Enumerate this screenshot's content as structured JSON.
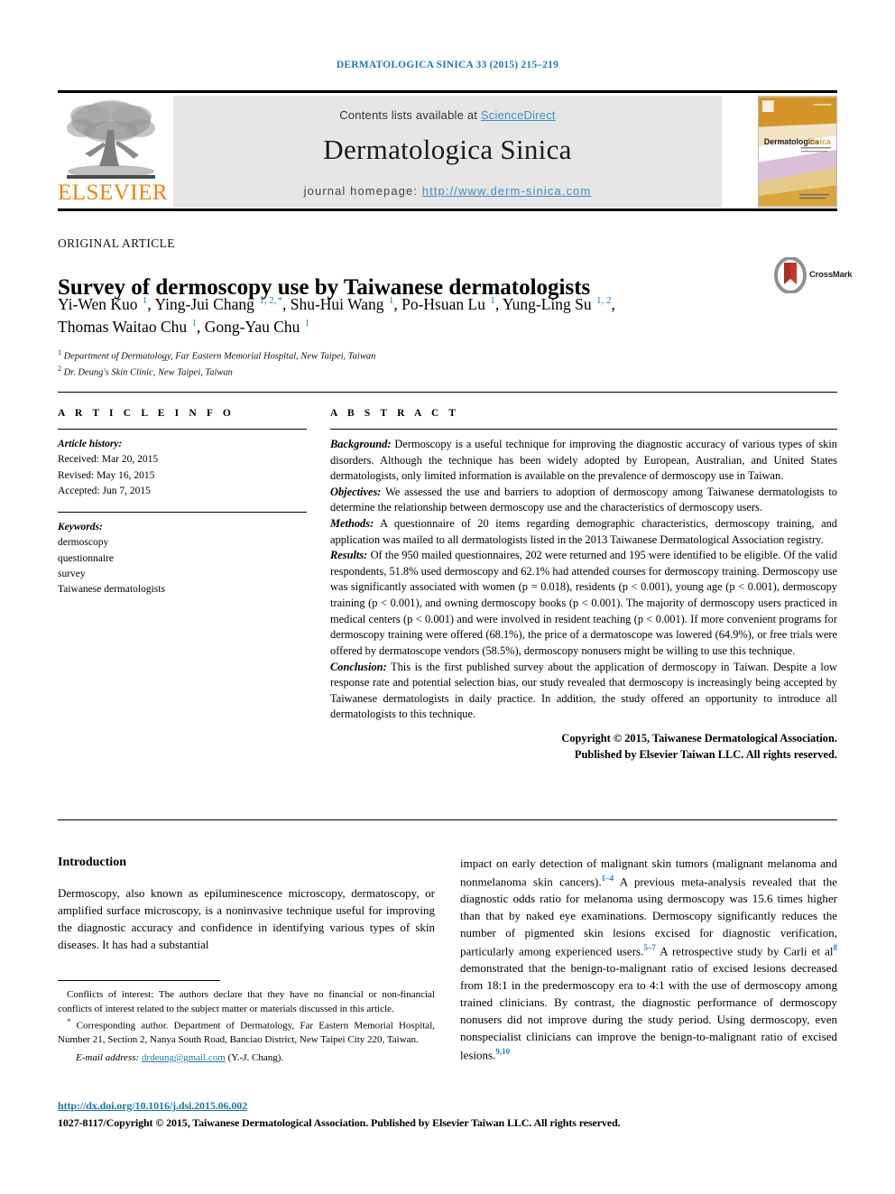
{
  "running_head": "DERMATOLOGICA SINICA 33 (2015) 215–219",
  "masthead": {
    "publisher_name": "ELSEVIER",
    "publisher_logo_icon": "elsevier-tree-logo",
    "contents_prefix": "Contents lists available at ",
    "contents_link": "ScienceDirect",
    "journal_title": "Dermatologica Sinica",
    "homepage_prefix": "journal homepage: ",
    "homepage_url": "http://www.derm-sinica.com",
    "cover_thumb_title": "Dermatologica Sinica"
  },
  "article": {
    "type": "ORIGINAL ARTICLE",
    "title": "Survey of dermoscopy use by Taiwanese dermatologists",
    "crossmark_label": "CrossMark",
    "authors_line1": "Yi-Wen Kuo",
    "authors_html": "Yi-Wen Kuo <sup>1</sup>, Ying-Jui Chang <sup>1, 2,</sup><sup>*</sup>, Shu-Hui Wang <sup>1</sup>, Po-Hsuan Lu <sup>1</sup>, Yung-Ling Su <sup>1, 2</sup>, Thomas Waitao Chu <sup>1</sup>, Gong-Yau Chu <sup>1</sup>",
    "affiliation_1": "Department of Dermatology, Far Eastern Memorial Hospital, New Taipei, Taiwan",
    "affiliation_2": "Dr. Deung's Skin Clinic, New Taipei, Taiwan"
  },
  "info": {
    "heading": "A R T I C L E   I N F O",
    "history_label": "Article history:",
    "history": [
      "Received: Mar 20, 2015",
      "Revised: May 16, 2015",
      "Accepted: Jun 7, 2015"
    ],
    "keywords_label": "Keywords:",
    "keywords": [
      "dermoscopy",
      "questionnaire",
      "survey",
      "Taiwanese dermatologists"
    ]
  },
  "abstract": {
    "heading": "A B S T R A C T",
    "background_label": "Background:",
    "background_text": " Dermoscopy is a useful technique for improving the diagnostic accuracy of various types of skin disorders. Although the technique has been widely adopted by European, Australian, and United States dermatologists, only limited information is available on the prevalence of dermoscopy use in Taiwan.",
    "objectives_label": "Objectives:",
    "objectives_text": " We assessed the use and barriers to adoption of dermoscopy among Taiwanese dermatologists to determine the relationship between dermoscopy use and the characteristics of dermoscopy users.",
    "methods_label": "Methods:",
    "methods_text": " A questionnaire of 20 items regarding demographic characteristics, dermoscopy training, and application was mailed to all dermatologists listed in the 2013 Taiwanese Dermatological Association registry.",
    "results_label": "Results:",
    "results_text": " Of the 950 mailed questionnaires, 202 were returned and 195 were identified to be eligible. Of the valid respondents, 51.8% used dermoscopy and 62.1% had attended courses for dermoscopy training. Dermoscopy use was significantly associated with women (p = 0.018), residents (p < 0.001), young age (p < 0.001), dermoscopy training (p < 0.001), and owning dermoscopy books (p < 0.001). The majority of dermoscopy users practiced in medical centers (p < 0.001) and were involved in resident teaching (p < 0.001). If more convenient programs for dermoscopy training were offered (68.1%), the price of a dermatoscope was lowered (64.9%), or free trials were offered by dermatoscope vendors (58.5%), dermoscopy nonusers might be willing to use this technique.",
    "conclusion_label": "Conclusion:",
    "conclusion_text": " This is the first published survey about the application of dermoscopy in Taiwan. Despite a low response rate and potential selection bias, our study revealed that dermoscopy is increasingly being accepted by Taiwanese dermatologists in daily practice. In addition, the study offered an opportunity to introduce all dermatologists to this technique.",
    "copyright_line1": "Copyright © 2015, Taiwanese Dermatological Association.",
    "copyright_line2": "Published by Elsevier Taiwan LLC. All rights reserved."
  },
  "body": {
    "intro_heading": "Introduction",
    "intro_left": "Dermoscopy, also known as epiluminescence microscopy, dermatoscopy, or amplified surface microscopy, is a noninvasive technique useful for improving the diagnostic accuracy and confidence in identifying various types of skin diseases. It has had a substantial",
    "intro_right_1": "impact on early detection of malignant skin tumors (malignant melanoma and nonmelanoma skin cancers).",
    "ref_1_4": "1–4",
    "intro_right_2": " A previous meta-analysis revealed that the diagnostic odds ratio for melanoma using dermoscopy was 15.6 times higher than that by naked eye examinations. Dermoscopy significantly reduces the number of pigmented skin lesions excised for diagnostic verification, particularly among experienced users.",
    "ref_5_7": "5–7",
    "intro_right_3": " A retrospective study by Carli et al",
    "ref_8": "8",
    "intro_right_4": " demonstrated that the benign-to-malignant ratio of excised lesions decreased from 18:1 in the predermoscopy era to 4:1 with the use of dermoscopy among trained clinicians. By contrast, the diagnostic performance of dermoscopy nonusers did not improve during the study period. Using dermoscopy, even nonspecialist clinicians can improve the benign-to-malignant ratio of excised lesions.",
    "ref_9_10": "9,10"
  },
  "footnotes": {
    "conflicts": "Conflicts of interest: The authors declare that they have no financial or non-financial conflicts of interest related to the subject matter or materials discussed in this article.",
    "corresponding_marker": "*",
    "corresponding": " Corresponding author. Department of Dermatology, Far Eastern Memorial Hospital, Number 21, Section 2, Nanya South Road, Banciao District, New Taipei City 220, Taiwan.",
    "email_label": "E-mail address:",
    "email": "drdeung@gmail.com",
    "email_suffix": " (Y.-J. Chang).",
    "doi": "http://dx.doi.org/10.1016/j.dsi.2015.06.002",
    "issn_line": "1027-8117/Copyright © 2015, Taiwanese Dermatological Association. Published by Elsevier Taiwan LLC. All rights reserved."
  },
  "colors": {
    "link_blue": "#1a7ba8",
    "sciencedirect_blue": "#3b8fc4",
    "elsevier_orange": "#ee8212",
    "banner_gray": "#e6e6e6",
    "superscript_blue": "#2980b9"
  }
}
